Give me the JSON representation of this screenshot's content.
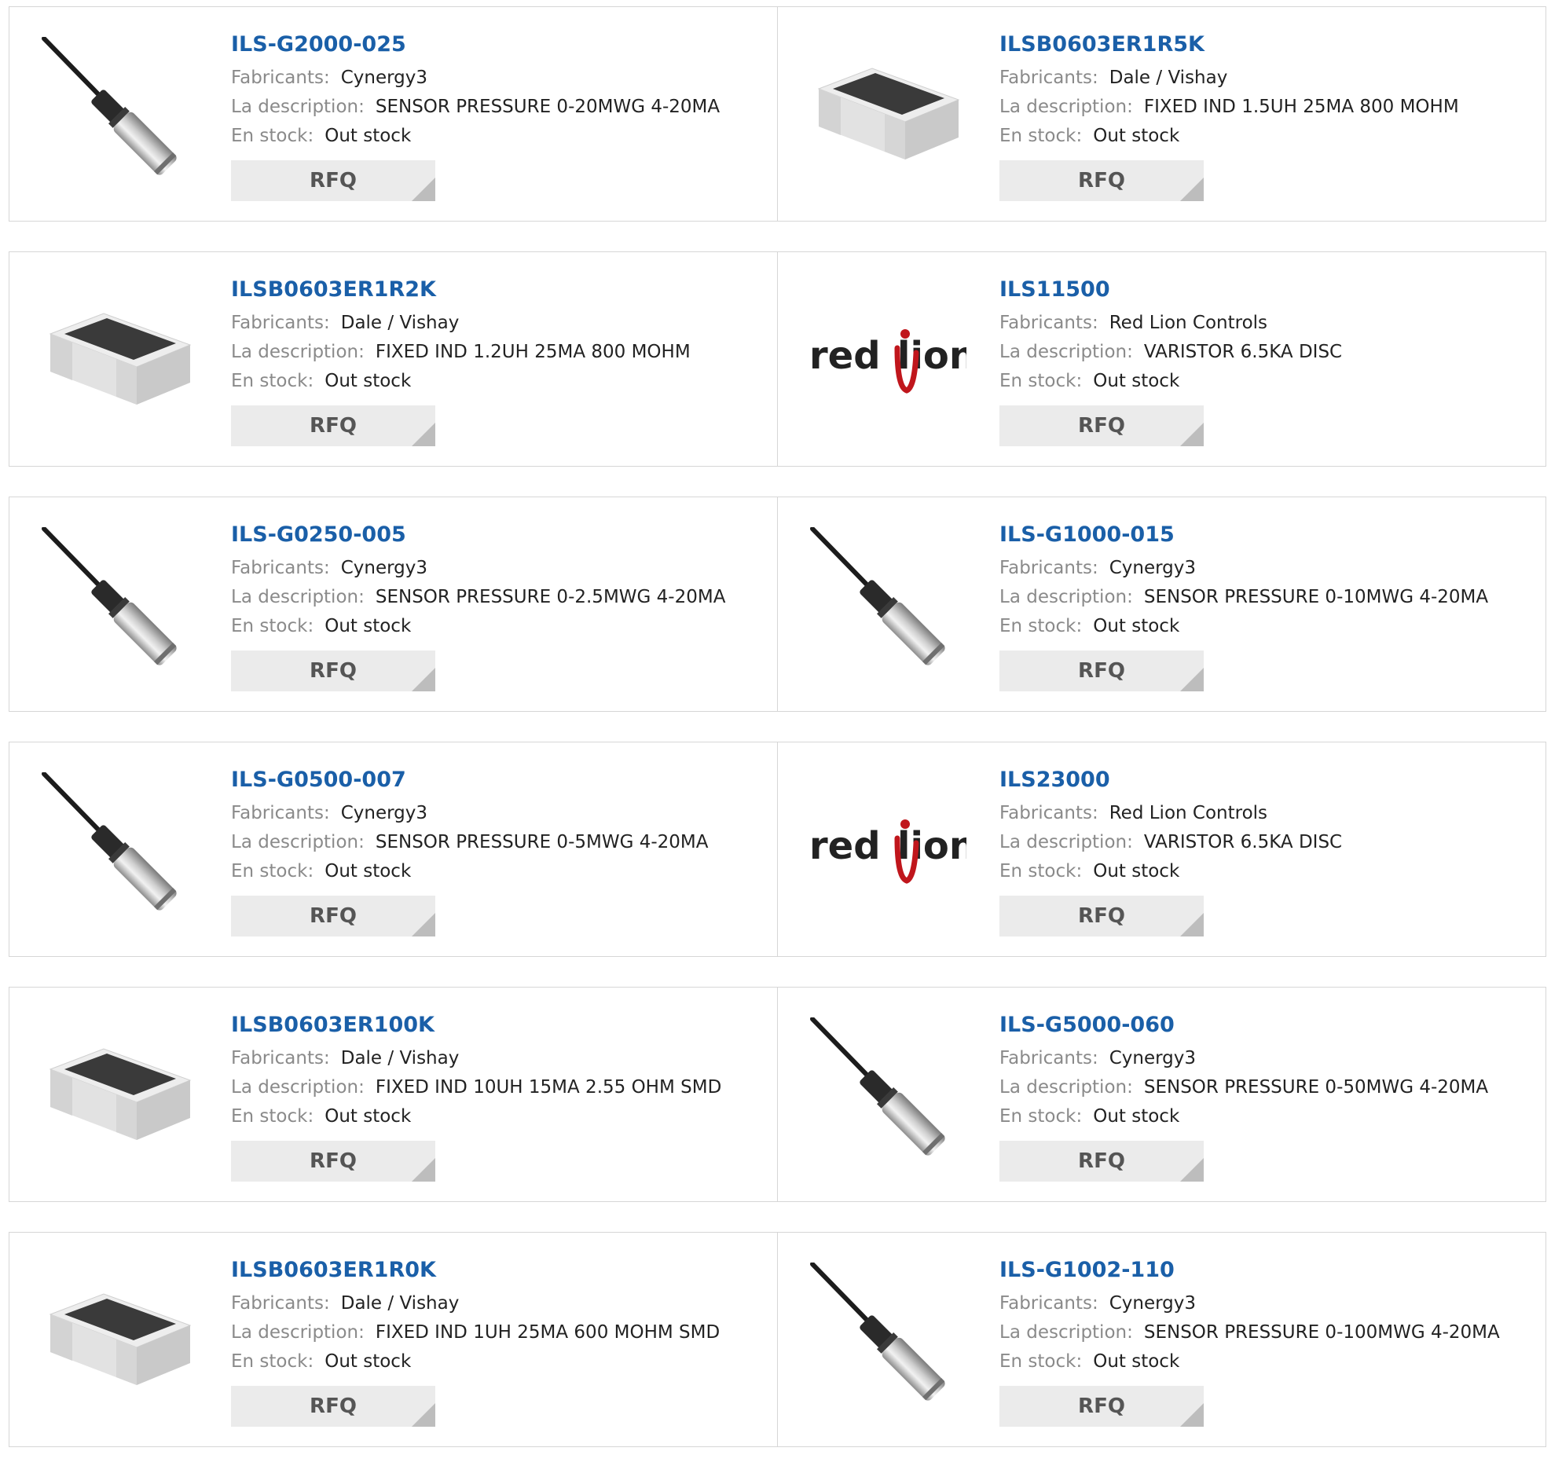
{
  "labels": {
    "manufacturer": "Fabricants:",
    "description": "La description:",
    "stock": "En stock:",
    "rfq": "RFQ"
  },
  "products": [
    {
      "pn": "ILS-G2000-025",
      "mfr": "Cynergy3",
      "desc": "SENSOR PRESSURE 0-20MWG 4-20MA",
      "stock": "Out stock",
      "image": "pressure-sensor-image"
    },
    {
      "pn": "ILSB0603ER1R5K",
      "mfr": "Dale / Vishay",
      "desc": "FIXED IND 1.5UH 25MA 800 MOHM",
      "stock": "Out stock",
      "image": "smd-inductor-image"
    },
    {
      "pn": "ILSB0603ER1R2K",
      "mfr": "Dale / Vishay",
      "desc": "FIXED IND 1.2UH 25MA 800 MOHM",
      "stock": "Out stock",
      "image": "smd-inductor-image"
    },
    {
      "pn": "ILS11500",
      "mfr": "Red Lion Controls",
      "desc": "VARISTOR 6.5KA DISC",
      "stock": "Out stock",
      "image": "red-lion-logo",
      "logo_text": "red lion"
    },
    {
      "pn": "ILS-G0250-005",
      "mfr": "Cynergy3",
      "desc": "SENSOR PRESSURE 0-2.5MWG 4-20MA",
      "stock": "Out stock",
      "image": "pressure-sensor-image"
    },
    {
      "pn": "ILS-G1000-015",
      "mfr": "Cynergy3",
      "desc": "SENSOR PRESSURE 0-10MWG 4-20MA",
      "stock": "Out stock",
      "image": "pressure-sensor-image"
    },
    {
      "pn": "ILS-G0500-007",
      "mfr": "Cynergy3",
      "desc": "SENSOR PRESSURE 0-5MWG 4-20MA",
      "stock": "Out stock",
      "image": "pressure-sensor-image"
    },
    {
      "pn": "ILS23000",
      "mfr": "Red Lion Controls",
      "desc": "VARISTOR 6.5KA DISC",
      "stock": "Out stock",
      "image": "red-lion-logo",
      "logo_text": "red lion"
    },
    {
      "pn": "ILSB0603ER100K",
      "mfr": "Dale / Vishay",
      "desc": "FIXED IND 10UH 15MA 2.55 OHM SMD",
      "stock": "Out stock",
      "image": "smd-inductor-image"
    },
    {
      "pn": "ILS-G5000-060",
      "mfr": "Cynergy3",
      "desc": "SENSOR PRESSURE 0-50MWG 4-20MA",
      "stock": "Out stock",
      "image": "pressure-sensor-image"
    },
    {
      "pn": "ILSB0603ER1R0K",
      "mfr": "Dale / Vishay",
      "desc": "FIXED IND 1UH 25MA 600 MOHM SMD",
      "stock": "Out stock",
      "image": "smd-inductor-image"
    },
    {
      "pn": "ILS-G1002-110",
      "mfr": "Cynergy3",
      "desc": "SENSOR PRESSURE 0-100MWG 4-20MA",
      "stock": "Out stock",
      "image": "pressure-sensor-image"
    }
  ],
  "colors": {
    "link": "#1a5fa8",
    "label": "#8a8a8a",
    "rfq_bg": "#ebebeb",
    "border": "#d6d6d6",
    "red_lion_red": "#c0161c"
  }
}
